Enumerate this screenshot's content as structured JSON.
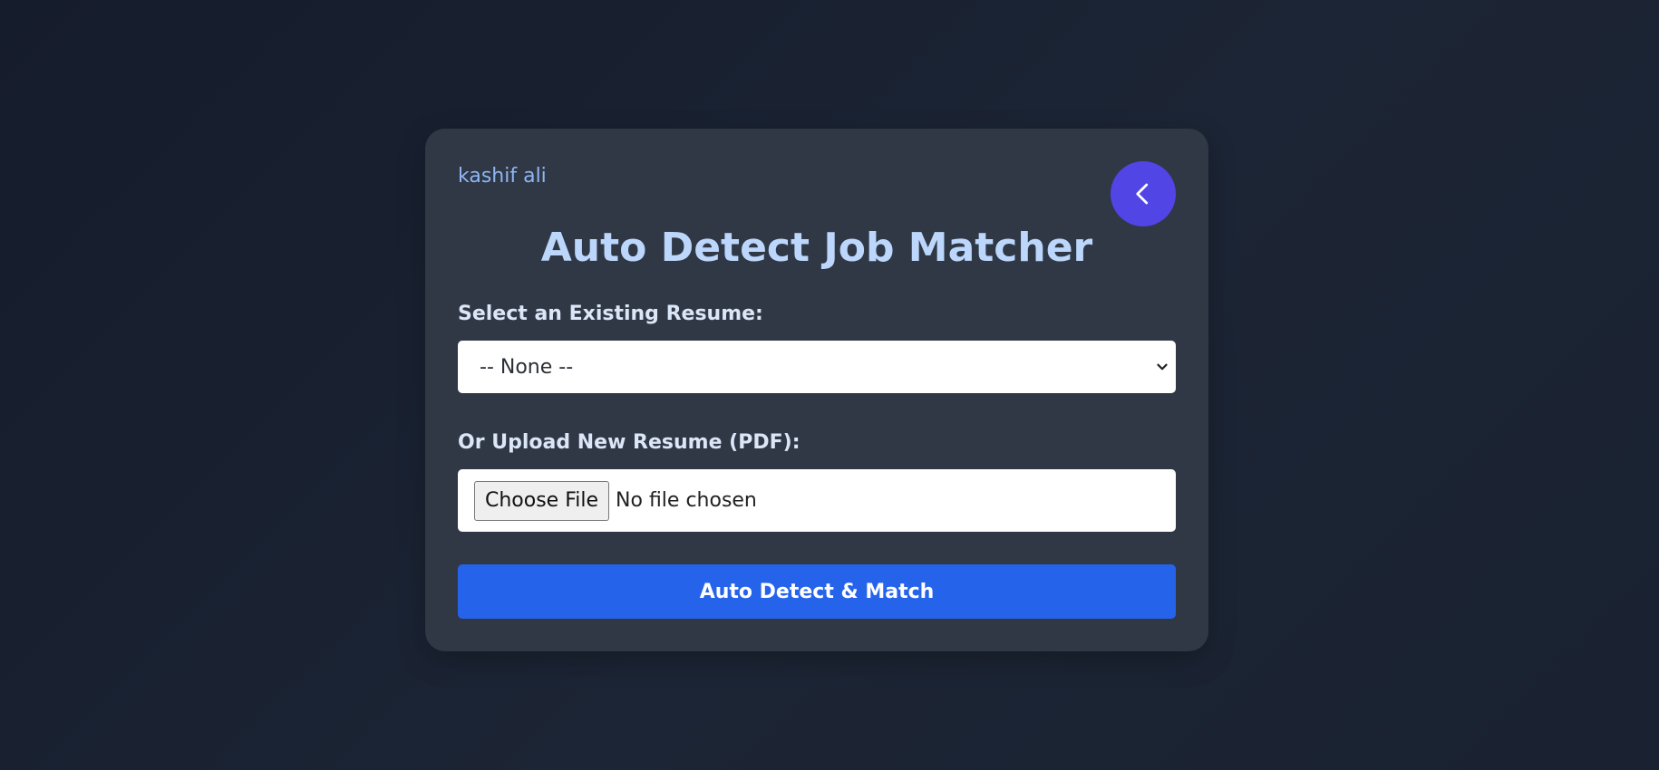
{
  "header": {
    "user_name": "kashif ali",
    "back_icon": "chevron-left-icon",
    "title": "Auto Detect Job Matcher"
  },
  "form": {
    "resume_select": {
      "label": "Select an Existing Resume:",
      "selected_value": "-- None --"
    },
    "upload": {
      "label": "Or Upload New Resume (PDF):",
      "button_label": "Choose File",
      "status_text": "No file chosen"
    },
    "submit_label": "Auto Detect & Match"
  },
  "colors": {
    "background": "#18202e",
    "card": "#303846",
    "accent_back_button": "#5145e5",
    "primary_button": "#2563eb",
    "title": "#bcd7fb",
    "user_name": "#8fb5f2"
  }
}
